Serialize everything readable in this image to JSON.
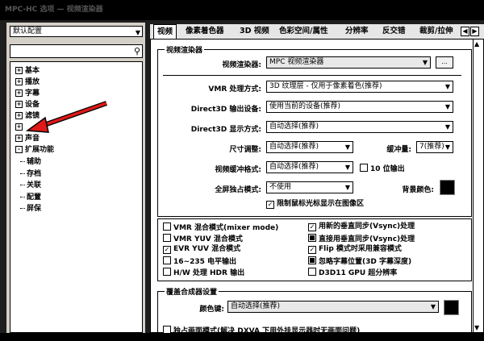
{
  "window": {
    "title": "MPC-HC 选项 — 视频渲染器"
  },
  "left": {
    "preset": "默认配置",
    "search_placeholder": "",
    "tree": [
      {
        "label": "基本",
        "toggle": "+"
      },
      {
        "label": "播放",
        "toggle": "+"
      },
      {
        "label": "字幕",
        "toggle": "+"
      },
      {
        "label": "设备",
        "toggle": "+"
      },
      {
        "label": "滤镜",
        "toggle": "+"
      },
      {
        "label": "",
        "toggle": "+"
      },
      {
        "label": "声音",
        "toggle": "+"
      },
      {
        "label": "扩展功能",
        "toggle": "-"
      }
    ],
    "children": [
      "辅助",
      "存档",
      "关联",
      "配置",
      "屏保"
    ]
  },
  "tabs": [
    "视频",
    "像素着色器",
    "3D 视频",
    "色彩空间/属性",
    "分辨率",
    "反交错",
    "裁剪/拉伸"
  ],
  "renderer_group": {
    "title": "视频渲染器",
    "renderer_label": "视频渲染器:",
    "renderer_value": "MPC 视频渲染器",
    "more_button": "...",
    "vmr_label": "VMR 处理方式:",
    "vmr_value": "3D 纹理层 - 仅用于像素着色(推荐)",
    "d3d_device_label": "Direct3D 输出设备:",
    "d3d_device_value": "使用当前的设备(推荐)",
    "d3d_display_label": "Direct3D 显示方式:",
    "d3d_display_value": "自动选择(推荐)",
    "resize_label": "尺寸调整:",
    "resize_value": "自动选择(推荐)",
    "buffer_label": "缓冲量:",
    "buffer_value": "7(推荐)",
    "surface_label": "视频缓冲格式:",
    "surface_value": "自动选择(推荐)",
    "tenbit_label": "10 位输出",
    "fullscreen_label": "全屏独占模式:",
    "fullscreen_value": "不使用",
    "bg_label": "背景颜色:",
    "bg_color": "#000000",
    "cursor_label": "限制鼠标光标显示在图像区"
  },
  "options": {
    "left": [
      {
        "label": "VMR 混合模式(mixer mode)",
        "state": "off"
      },
      {
        "label": "VMR YUV 混合模式",
        "state": "off"
      },
      {
        "label": "EVR YUV 混合模式",
        "state": "on"
      },
      {
        "label": "16~235 电平输出",
        "state": "off"
      },
      {
        "label": "H/W 处理 HDR 输出",
        "state": "off"
      }
    ],
    "right": [
      {
        "label": "用新的垂直同步(Vsync)处理",
        "state": "on"
      },
      {
        "label": "直接用垂直同步(Vsync)处理",
        "state": "filled"
      },
      {
        "label": "Flip 模式时采用兼容模式",
        "state": "on"
      },
      {
        "label": "忽略字幕位置(3D 字幕深度)",
        "state": "filled"
      },
      {
        "label": "D3D11 GPU 超分辨率",
        "state": "off"
      }
    ]
  },
  "overlay_group": {
    "title": "覆盖合成器设置",
    "color_label": "颜色键:",
    "color_value": "自动选择(推荐)",
    "color_swatch": "#000000",
    "bottom_text": "独占画面模式(解决 DXVA 下用外挂显示器时无画面问题)"
  }
}
